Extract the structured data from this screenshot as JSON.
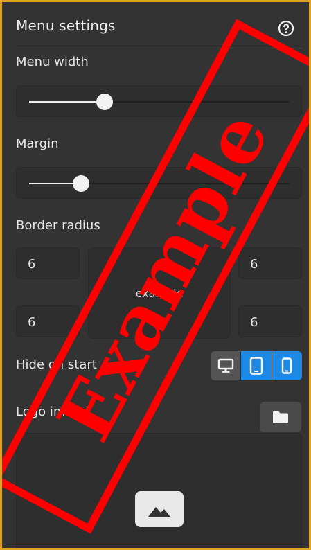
{
  "panel": {
    "title": "Menu settings",
    "help_icon": "help-circle-icon",
    "border_color": "#e0a325",
    "background": "#333333"
  },
  "menu_width": {
    "label": "Menu width",
    "value_fraction": 0.29
  },
  "margin": {
    "label": "Margin",
    "value_fraction": 0.2
  },
  "border_radius": {
    "label": "Border radius",
    "top_left": "6",
    "top_right": "6",
    "bottom_left": "6",
    "bottom_right": "6",
    "preview_text": "example"
  },
  "hide_on_start": {
    "label": "Hide on start",
    "options": [
      {
        "icon": "desktop-icon",
        "selected": false
      },
      {
        "icon": "tablet-icon",
        "selected": true
      },
      {
        "icon": "mobile-icon",
        "selected": true
      }
    ],
    "selected_color": "#1e88e5"
  },
  "logo_image": {
    "label": "Logo image",
    "folder_icon": "folder-icon",
    "placeholder_icon": "image-icon"
  },
  "watermark": {
    "text": "Example",
    "color": "#ff0000"
  }
}
